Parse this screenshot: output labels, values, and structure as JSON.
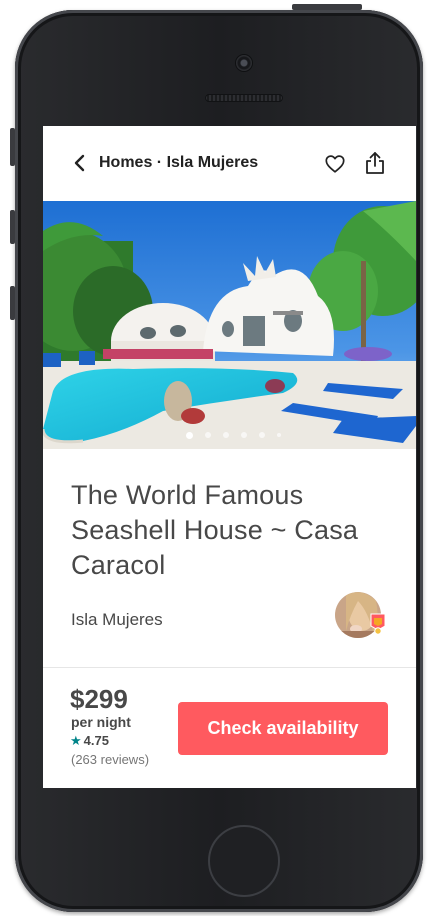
{
  "nav": {
    "back_icon": "chevron-left-icon",
    "title": "Homes · Isla Mujeres",
    "favorite_icon": "heart-outline-icon",
    "share_icon": "share-icon"
  },
  "hero": {
    "photo_count_dots": 6,
    "active_index": 0
  },
  "listing": {
    "title": "The World Famous Seashell House ~ Casa Caracol",
    "location": "Isla Mujeres"
  },
  "booking": {
    "price": "$299",
    "per_night": "per night",
    "rating": "4.75",
    "reviews": "(263 reviews)",
    "cta_label": "Check availability"
  },
  "colors": {
    "accent": "#FF5A5F",
    "star": "#008489",
    "text": "#484848"
  }
}
